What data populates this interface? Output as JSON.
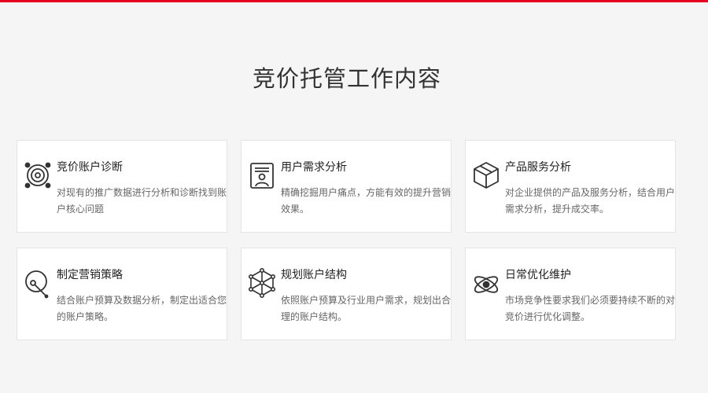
{
  "accent_color": "#e60023",
  "section": {
    "title": "竞价托管工作内容"
  },
  "cards": [
    {
      "title": "竞价账户诊断",
      "desc": "对现有的推广数据进行分析和诊断找到账户核心问题",
      "icon": "target-icon"
    },
    {
      "title": "用户需求分析",
      "desc": "精确挖掘用户痛点，方能有效的提升营销效果。",
      "icon": "user-profile-icon"
    },
    {
      "title": "产品服务分析",
      "desc": "对企业提供的产品及服务分析，结合用户需求分析，提升成交率。",
      "icon": "cube-icon"
    },
    {
      "title": "制定营销策略",
      "desc": "结合账户预算及数据分析，制定出适合您的账户策略。",
      "icon": "strategy-icon"
    },
    {
      "title": "规划账户结构",
      "desc": "依照账户预算及行业用户需求，规划出合理的账户结构。",
      "icon": "network-icon"
    },
    {
      "title": "日常优化维护",
      "desc": "市场竞争性要求我们必须要持续不断的对竞价进行优化调整。",
      "icon": "atom-icon"
    }
  ]
}
